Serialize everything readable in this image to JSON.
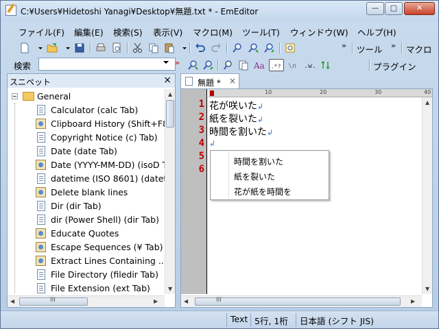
{
  "window": {
    "title": "C:¥Users¥Hidetoshi Yanagi¥Desktop¥無題.txt * - EmEditor",
    "minimize_glyph": "—",
    "maximize_glyph": "□",
    "close_glyph": "✕"
  },
  "menu": [
    {
      "label": "ファイル(F)"
    },
    {
      "label": "編集(E)"
    },
    {
      "label": "検索(S)"
    },
    {
      "label": "表示(V)"
    },
    {
      "label": "マクロ(M)"
    },
    {
      "label": "ツール(T)"
    },
    {
      "label": "ウィンドウ(W)"
    },
    {
      "label": "ヘルプ(H)"
    }
  ],
  "toolbar": {
    "tools_label": "ツール",
    "macro_label": "マクロ",
    "plugins_label": "プラグイン",
    "overflow": "»"
  },
  "search": {
    "label": "検索",
    "value": ""
  },
  "panel": {
    "title": "スニペット",
    "close": "×",
    "root": "General",
    "items": [
      {
        "label": "Calculator  (calc Tab)",
        "icon": "document-icon"
      },
      {
        "label": "Clipboard History  (Shift+F8)",
        "icon": "macro-icon"
      },
      {
        "label": "Copyright Notice  (c) Tab)",
        "icon": "document-icon"
      },
      {
        "label": "Date  (date Tab)",
        "icon": "document-icon"
      },
      {
        "label": "Date (YYYY-MM-DD)  (isoD T",
        "icon": "macro-icon"
      },
      {
        "label": "datetime (ISO 8601)  (datet",
        "icon": "document-icon"
      },
      {
        "label": "Delete blank lines",
        "icon": "macro-icon"
      },
      {
        "label": "Dir  (dir Tab)",
        "icon": "document-icon"
      },
      {
        "label": "dir (Power Shell)  (dir Tab)",
        "icon": "document-icon"
      },
      {
        "label": "Educate Quotes",
        "icon": "macro-icon"
      },
      {
        "label": "Escape Sequences  (¥ Tab)",
        "icon": "macro-icon"
      },
      {
        "label": "Extract Lines Containing ...",
        "icon": "macro-icon"
      },
      {
        "label": "File Directory  (filedir Tab)",
        "icon": "document-icon"
      },
      {
        "label": "File Extension  (ext Tab)",
        "icon": "document-icon"
      }
    ],
    "hscroll_grip": "III"
  },
  "editor": {
    "tab_label": "無題 *",
    "tab_close": "×",
    "ruler": [
      "10",
      "20",
      "30",
      "40"
    ],
    "line_numbers": [
      "1",
      "2",
      "3",
      "4",
      "5",
      "6"
    ],
    "lines": [
      "花が咲いた",
      "紙を裂いた",
      "時間を割いた",
      ""
    ],
    "eol": "↲",
    "hscroll_grip": "III"
  },
  "context_menu": {
    "items": [
      "時間を割いた",
      "紙を裂いた",
      "花が紙を時間を"
    ]
  },
  "status": {
    "mode": "Text",
    "position": "5行, 1桁",
    "encoding": "日本語 (シフト JIS)"
  }
}
